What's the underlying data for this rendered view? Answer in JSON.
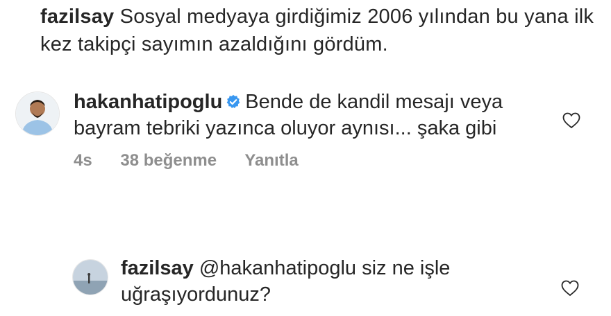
{
  "caption": {
    "username": "fazilsay",
    "text": "Sosyal medyaya girdiğimiz 2006 yılından bu yana ilk kez takipçi sayımın azaldığını gördüm."
  },
  "comment": {
    "username": "hakanhatipoglu",
    "verified_icon": "verified-badge-icon",
    "text": "Bende de kandil mesajı veya bayram tebriki yazınca oluyor aynısı... şaka gibi",
    "time": "4s",
    "likes": "38 beğenme",
    "reply_label": "Yanıtla",
    "like_icon": "heart-outline-icon"
  },
  "reply": {
    "username": "fazilsay",
    "text": "@hakanhatipoglu siz ne işle uğraşıyordunuz?",
    "like_icon": "heart-outline-icon"
  },
  "colors": {
    "text": "#262626",
    "muted": "#8e8e8e",
    "verified": "#3897f0"
  }
}
